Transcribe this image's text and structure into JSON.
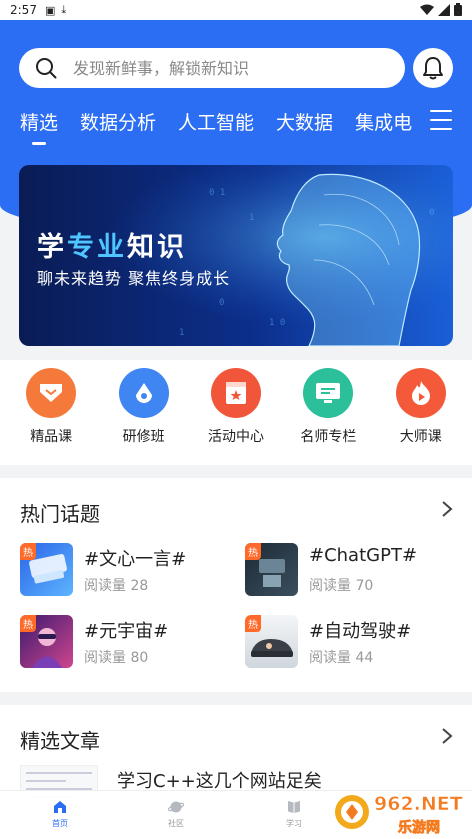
{
  "status_bar": {
    "time": "2:57"
  },
  "search": {
    "placeholder": "发现新鲜事，解锁新知识"
  },
  "tabs": [
    {
      "label": "精选",
      "active": true
    },
    {
      "label": "数据分析"
    },
    {
      "label": "人工智能"
    },
    {
      "label": "大数据"
    },
    {
      "label": "集成电"
    }
  ],
  "banner": {
    "title_part1": "学",
    "title_highlight": "专业",
    "title_part2": "知识",
    "subtitle": "聊未来趋势  聚焦终身成长"
  },
  "quick_links": [
    {
      "label": "精品课",
      "color": "#f5793b",
      "icon": "diamond-icon"
    },
    {
      "label": "研修班",
      "color": "#3f86f2",
      "icon": "drop-icon"
    },
    {
      "label": "活动中心",
      "color": "#f2563a",
      "icon": "flag-icon"
    },
    {
      "label": "名师专栏",
      "color": "#2bbf9a",
      "icon": "screen-icon"
    },
    {
      "label": "大师课",
      "color": "#f45a39",
      "icon": "flame-icon"
    }
  ],
  "hot_topics": {
    "title": "热门话题",
    "badge": "热",
    "items": [
      {
        "name": "#文心一言#",
        "reads": "阅读量 28"
      },
      {
        "name": "#ChatGPT#",
        "reads": "阅读量 70"
      },
      {
        "name": "#元宇宙#",
        "reads": "阅读量 80"
      },
      {
        "name": "#自动驾驶#",
        "reads": "阅读量 44"
      }
    ]
  },
  "articles": {
    "title": "精选文章",
    "items": [
      {
        "title": "学习C++这几个网站足矣"
      }
    ]
  },
  "bottom_nav": [
    {
      "label": "首页",
      "active": true
    },
    {
      "label": "社区"
    },
    {
      "label": "学习"
    }
  ],
  "watermark": {
    "brand": "962.NET",
    "sub": "乐游网"
  }
}
